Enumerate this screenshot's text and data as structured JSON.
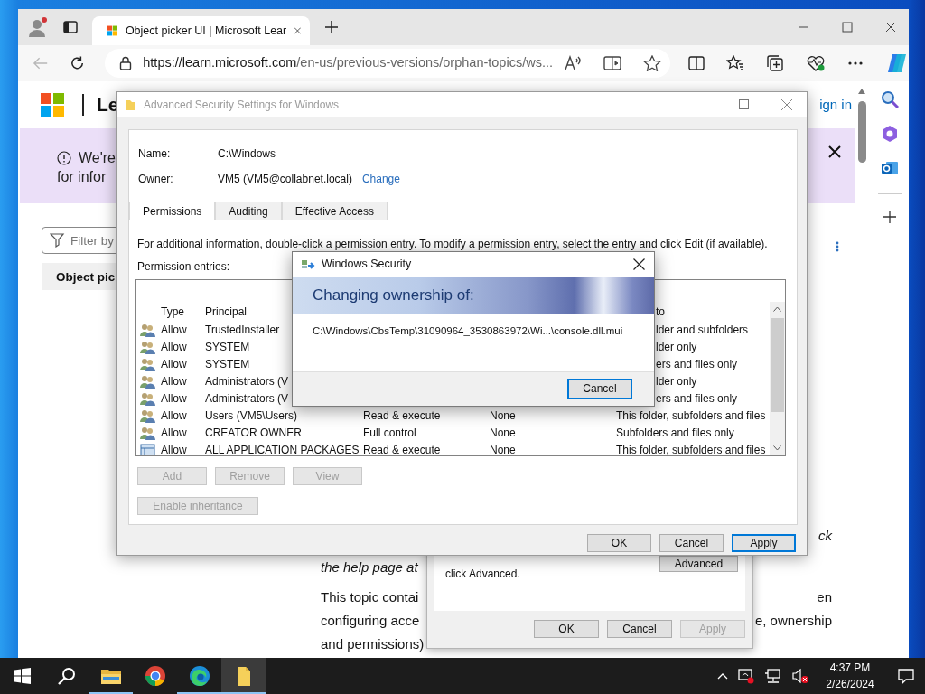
{
  "browser": {
    "tabs": [
      {
        "title": "Object picker UI | Microsoft Lear",
        "selected": true
      }
    ],
    "url_host": "https://learn.microsoft.com",
    "url_path": "/en-us/previous-versions/orphan-topics/ws..."
  },
  "page": {
    "brand": "Le",
    "sign_in": "ign in",
    "banner": {
      "lines": [
        "We're",
        "for infor"
      ]
    },
    "filter": {
      "placeholder": "Filter by"
    },
    "toc": [
      {
        "label": "Object pic",
        "selected": true
      }
    ],
    "article": [
      {
        "right": "ck",
        "italic": true
      },
      {
        "left": "the help page at",
        "italic": true
      },
      {
        "left": "This topic contai",
        "right": "en",
        "italic": false
      },
      {
        "left": "configuring acce",
        "right": "e, ownership",
        "italic": false
      },
      {
        "left": "and permissions)",
        "italic": false
      }
    ]
  },
  "properties_dialog": {
    "hint": "click Advanced.",
    "advanced_button": "Advanced",
    "buttons": [
      {
        "label": "OK",
        "disabled": false
      },
      {
        "label": "Cancel",
        "disabled": false
      },
      {
        "label": "Apply",
        "disabled": true
      }
    ]
  },
  "advanced_dialog": {
    "title": "Advanced Security Settings for Windows",
    "active": false,
    "name_label": "Name:",
    "name": "C:\\Windows",
    "owner_label": "Owner:",
    "owner": "VM5 (VM5@collabnet.local)",
    "change_link": "Change",
    "tabs": [
      {
        "label": "Permissions",
        "selected": true
      },
      {
        "label": "Auditing",
        "selected": false
      },
      {
        "label": "Effective Access",
        "selected": false
      }
    ],
    "info": "For additional information, double-click a permission entry. To modify a permission entry, select the entry and click Edit (if available).",
    "entries_label": "Permission entries:",
    "columns": {
      "type": "Type",
      "principal": "Principal",
      "applies_to": "to"
    },
    "rows": [
      {
        "kind": "group",
        "type": "Allow",
        "principal": "TrustedInstaller",
        "applies_to": "lder and subfolders"
      },
      {
        "kind": "group",
        "type": "Allow",
        "principal": "SYSTEM",
        "applies_to": "lder only"
      },
      {
        "kind": "group",
        "type": "Allow",
        "principal": "SYSTEM",
        "applies_to": "ers and files only"
      },
      {
        "kind": "group",
        "type": "Allow",
        "principal": "Administrators (V",
        "applies_to": "lder only"
      },
      {
        "kind": "group",
        "type": "Allow",
        "principal": "Administrators (V",
        "applies_to": "ers and files only"
      },
      {
        "kind": "group",
        "type": "Allow",
        "principal": "Users (VM5\\Users)",
        "access": "Read & execute",
        "inherited": "None",
        "applies_to": "This folder, subfolders and files"
      },
      {
        "kind": "group",
        "type": "Allow",
        "principal": "CREATOR OWNER",
        "access": "Full control",
        "inherited": "None",
        "applies_to": "Subfolders and files only"
      },
      {
        "kind": "package",
        "type": "Allow",
        "principal": "ALL APPLICATION PACKAGES",
        "access": "Read & execute",
        "inherited": "None",
        "applies_to": "This folder, subfolders and files"
      }
    ],
    "row_buttons": [
      {
        "label": "Add",
        "disabled": true
      },
      {
        "label": "Remove",
        "disabled": true
      },
      {
        "label": "View",
        "disabled": true
      }
    ],
    "inheritance_button": {
      "label": "Enable inheritance",
      "disabled": true
    },
    "buttons": [
      {
        "label": "OK",
        "default": false
      },
      {
        "label": "Cancel",
        "default": false
      },
      {
        "label": "Apply",
        "default": true
      }
    ]
  },
  "security_dialog": {
    "title": "Windows Security",
    "heading": "Changing ownership of:",
    "path": "C:\\Windows\\CbsTemp\\31090964_3530863972\\Wi...\\console.dll.mui",
    "cancel": "Cancel"
  },
  "taskbar": {
    "apps": [
      {
        "kind": "folder",
        "running": true,
        "selected": false
      },
      {
        "kind": "chrome",
        "running": false,
        "selected": false
      },
      {
        "kind": "edge",
        "running": true,
        "selected": false
      },
      {
        "kind": "files",
        "running": true,
        "selected": true
      }
    ],
    "time": "4:37 PM",
    "date": "2/26/2024"
  }
}
